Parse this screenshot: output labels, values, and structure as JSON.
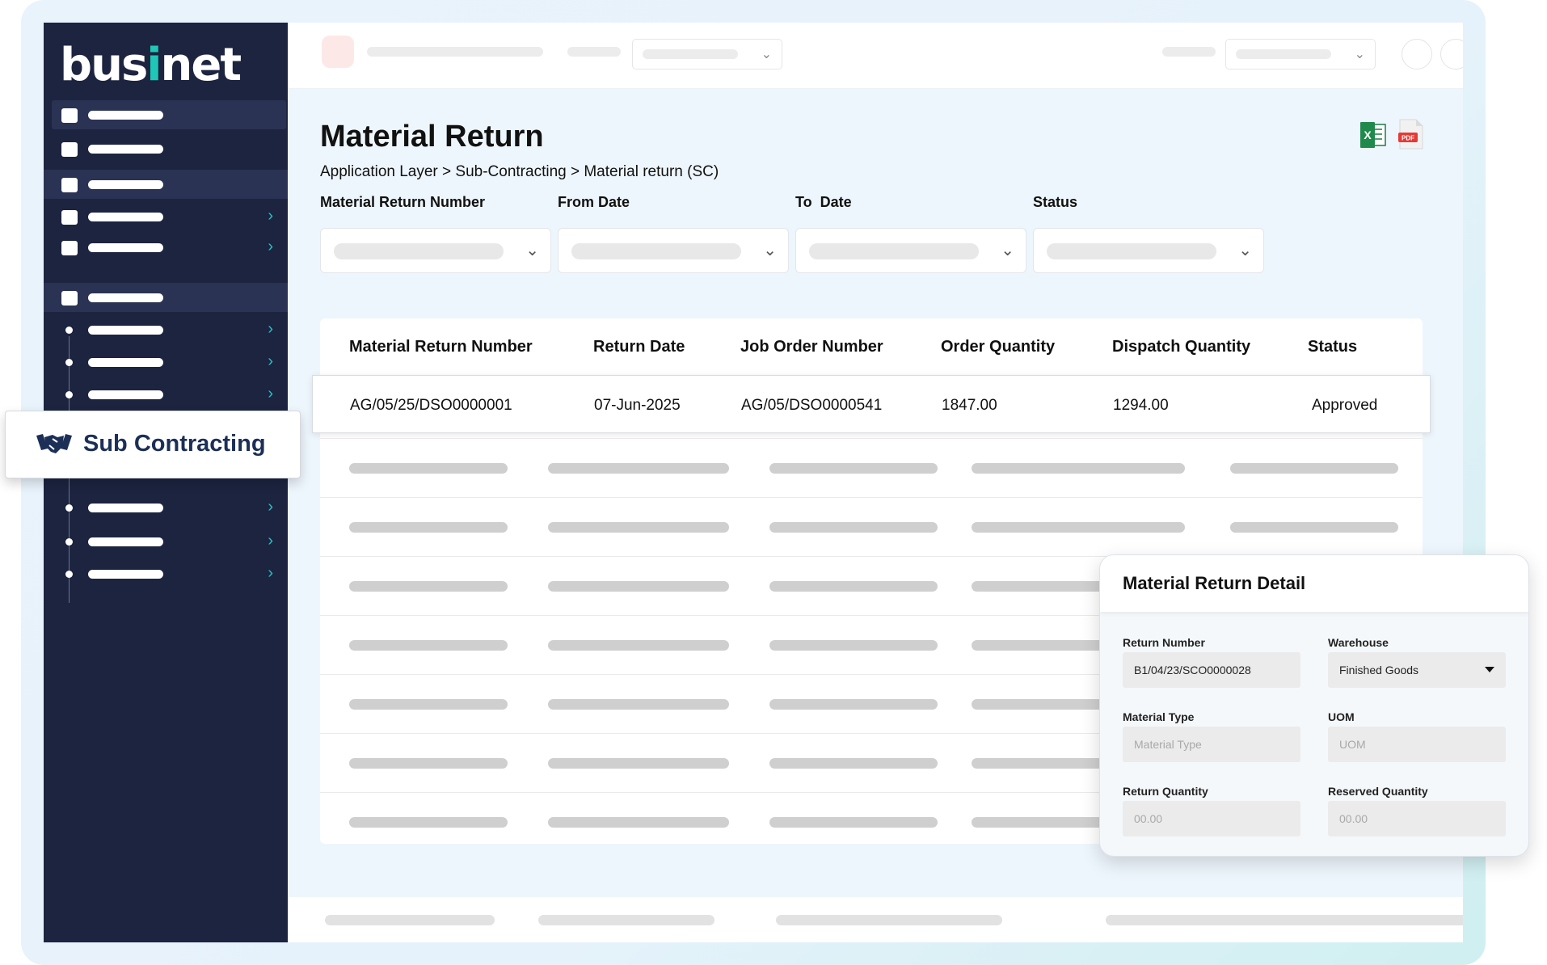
{
  "app": {
    "logo_text_a": "bus",
    "logo_text_i": "i",
    "logo_text_b": "net"
  },
  "page": {
    "title": "Material Return",
    "breadcrumb": "Application Layer > Sub-Contracting > Material return (SC)"
  },
  "exports": {
    "excel_icon": "excel-icon",
    "pdf_icon": "pdf-icon",
    "pdf_text": "PDF"
  },
  "filters": [
    {
      "label": "Material Return Number"
    },
    {
      "label": "From Date"
    },
    {
      "label": "To  Date"
    },
    {
      "label": "Status"
    }
  ],
  "table": {
    "columns": [
      "Material Return Number",
      "Return Date",
      "Job Order Number",
      "Order Quantity",
      "Dispatch Quantity",
      "Status"
    ],
    "rows": [
      [
        "AG/05/25/DSO0000001",
        "07-Jun-2025",
        "AG/05/DSO0000541",
        "1847.00",
        "1294.00",
        "Approved"
      ]
    ]
  },
  "sidebar": {
    "highlight_label": "Sub Contracting",
    "highlight_icon": "handshake-icon",
    "chevron_icon": "chevron-right-icon"
  },
  "detail": {
    "title": "Material Return Detail",
    "fields": {
      "return_number": {
        "label": "Return Number",
        "value": "B1/04/23/SCO0000028"
      },
      "warehouse": {
        "label": "Warehouse",
        "value": "Finished Goods"
      },
      "material_type": {
        "label": "Material Type",
        "placeholder": "Material Type"
      },
      "uom": {
        "label": "UOM",
        "placeholder": "UOM"
      },
      "return_quantity": {
        "label": "Return Quantity",
        "placeholder": "00.00"
      },
      "reserved_quantity": {
        "label": "Reserved Quantity",
        "placeholder": "00.00"
      }
    }
  },
  "colors": {
    "sidebar": "#1c2440",
    "accent": "#1fc7b7",
    "brand_text": "#1c2f57",
    "main_bg": "#eef6fd"
  }
}
